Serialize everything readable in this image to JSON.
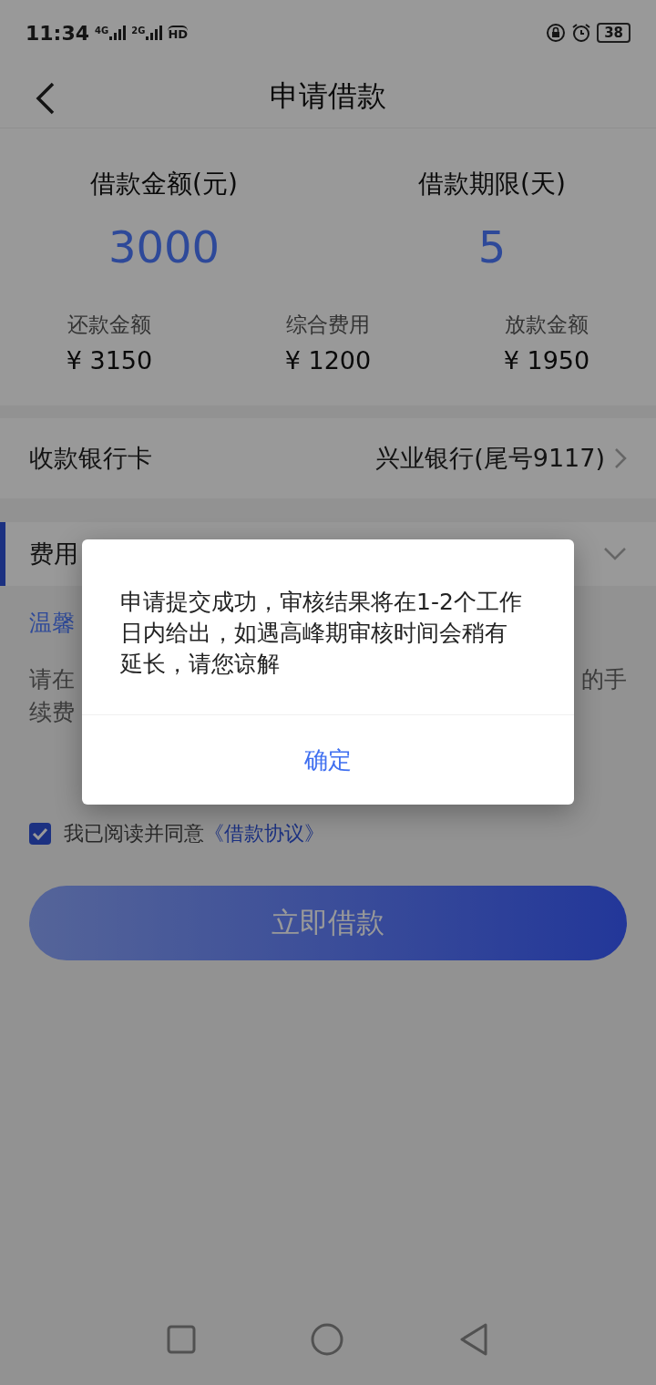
{
  "status_bar": {
    "time": "11:34",
    "network": [
      "4G",
      "2G"
    ],
    "hd": "HD",
    "battery": "38"
  },
  "header": {
    "title": "申请借款"
  },
  "loan": {
    "amount_label": "借款金额(元)",
    "amount": "3000",
    "term_label": "借款期限(天)",
    "term": "5"
  },
  "summary": [
    {
      "label": "还款金额",
      "value": "¥ 3150"
    },
    {
      "label": "综合费用",
      "value": "¥ 1200"
    },
    {
      "label": "放款金额",
      "value": "¥ 1950"
    }
  ],
  "bank_card": {
    "label": "收款银行卡",
    "value": "兴业银行(尾号9117)"
  },
  "fee_section": {
    "label": "费用"
  },
  "tips": {
    "title": "温馨",
    "line_1_start": "请在",
    "line_1_end": "的手",
    "line_2_start": "续费"
  },
  "agreement": {
    "checked": true,
    "text": "我已阅读并同意",
    "link": "《借款协议》"
  },
  "submit_button": "立即借款",
  "dialog": {
    "message": "申请提交成功，审核结果将在1-2个工作日内给出，如遇高峰期审核时间会稍有延长，请您谅解",
    "confirm": "确定"
  }
}
